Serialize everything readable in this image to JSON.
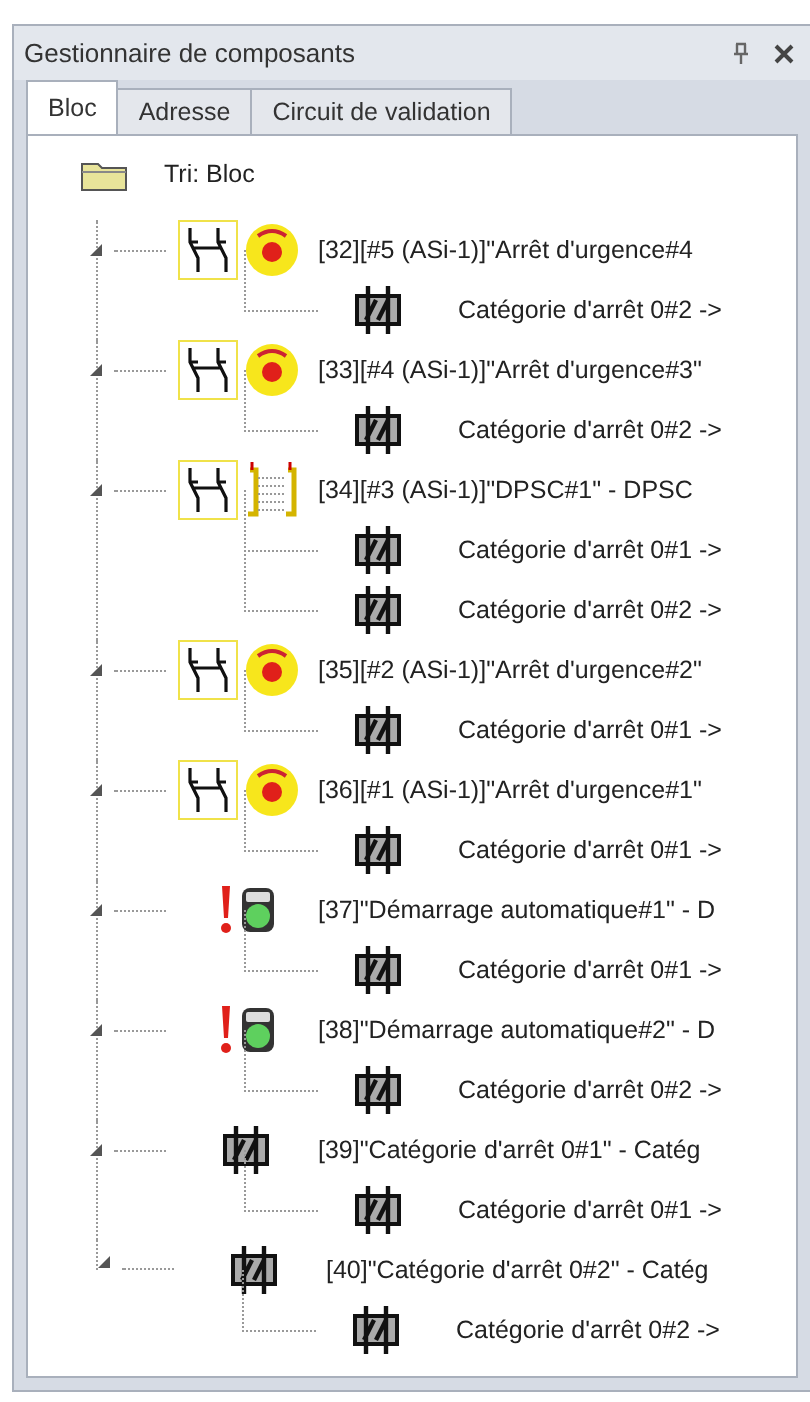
{
  "panel": {
    "title": "Gestionnaire de composants"
  },
  "tabs": [
    {
      "label": "Bloc",
      "selected": true
    },
    {
      "label": "Adresse",
      "selected": false
    },
    {
      "label": "Circuit de validation",
      "selected": false
    }
  ],
  "tree": {
    "root": {
      "label": "Tri: Bloc"
    },
    "items": [
      {
        "label": "[32][#5 (ASi-1)]\"Arrêt d'urgence#4",
        "kind": "estop",
        "expanded": true,
        "children": [
          {
            "label": "Catégorie d'arrêt 0#2 ->"
          }
        ]
      },
      {
        "label": "[33][#4 (ASi-1)]\"Arrêt d'urgence#3\"",
        "kind": "estop",
        "expanded": true,
        "children": [
          {
            "label": "Catégorie d'arrêt 0#2 ->"
          }
        ]
      },
      {
        "label": "[34][#3 (ASi-1)]\"DPSC#1\" - DPSC",
        "kind": "dpsc",
        "expanded": true,
        "children": [
          {
            "label": "Catégorie d'arrêt 0#1 ->"
          },
          {
            "label": "Catégorie d'arrêt 0#2 ->"
          }
        ]
      },
      {
        "label": "[35][#2 (ASi-1)]\"Arrêt d'urgence#2\"",
        "kind": "estop",
        "expanded": true,
        "children": [
          {
            "label": "Catégorie d'arrêt 0#1 ->"
          }
        ]
      },
      {
        "label": "[36][#1 (ASi-1)]\"Arrêt d'urgence#1\"",
        "kind": "estop",
        "expanded": true,
        "children": [
          {
            "label": "Catégorie d'arrêt 0#1 ->"
          }
        ]
      },
      {
        "label": "[37]\"Démarrage automatique#1\" - D",
        "kind": "autostart",
        "expanded": true,
        "children": [
          {
            "label": "Catégorie d'arrêt 0#1 ->"
          }
        ]
      },
      {
        "label": "[38]\"Démarrage automatique#2\" - D",
        "kind": "autostart",
        "expanded": true,
        "children": [
          {
            "label": "Catégorie d'arrêt 0#2 ->"
          }
        ]
      },
      {
        "label": "[39]\"Catégorie d'arrêt 0#1\" - Catég",
        "kind": "stopcat",
        "expanded": true,
        "children": [
          {
            "label": "Catégorie d'arrêt 0#1 ->"
          }
        ]
      },
      {
        "label": "[40]\"Catégorie d'arrêt 0#2\" - Catég",
        "kind": "stopcat",
        "expanded": true,
        "children": [
          {
            "label": "Catégorie d'arrêt 0#2 ->"
          }
        ]
      }
    ]
  }
}
